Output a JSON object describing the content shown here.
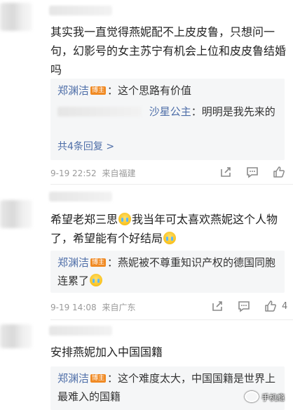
{
  "comments": [
    {
      "text": "其实我一直觉得燕妮配不上皮皮鲁，只想问一句，幻影号的女主苏宁有机会上位和皮皮鲁结婚吗",
      "replies": [
        {
          "name": "郑渊洁",
          "badge": "博主",
          "text": "：这个思路有价值"
        },
        {
          "name": "沙星公主",
          "text": "：明明是我先来的"
        }
      ],
      "more_replies": "共4条回复 >",
      "time": "9-19 22:52",
      "location": "来自福建",
      "likes": ""
    },
    {
      "text_a": "希望老郑三思",
      "text_b": "我当年可太喜欢燕妮这个人物了，希望能有个好结局",
      "replies": [
        {
          "name": "郑渊洁",
          "badge": "博主",
          "text": "：燕妮被不尊重知识产权的德国同胞连累了"
        }
      ],
      "time": "9-19 14:08",
      "location": "来自广东",
      "likes": "4"
    },
    {
      "text": "安排燕妮加入中国国籍",
      "replies": [
        {
          "name": "郑渊洁",
          "badge": "博主",
          "text": "：这个难度太大，中国国籍是世界上最难入的国籍"
        }
      ]
    }
  ],
  "watermark": "手机瘾",
  "icons": [
    "share-icon",
    "comment-icon",
    "like-icon",
    "crying-emoji-icon"
  ],
  "colors": {
    "link": "#4e6ea8",
    "badge": "#f08a24",
    "reply_bg": "#f5f6f7"
  }
}
